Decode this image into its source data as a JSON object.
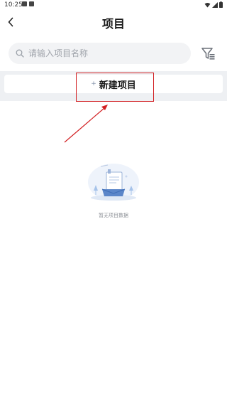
{
  "status_bar": {
    "time": "10:25"
  },
  "header": {
    "title": "项目",
    "back_icon": "chevron-left-icon"
  },
  "search": {
    "placeholder": "请输入项目名称",
    "value": "",
    "icon": "search-icon"
  },
  "filter": {
    "icon": "filter-icon"
  },
  "new_project": {
    "plus": "+",
    "label": "新建项目"
  },
  "empty_state": {
    "text": "暂无项目数据",
    "icon": "empty-box-illustration"
  },
  "colors": {
    "highlight": "#d21f22",
    "band": "#eef0f3",
    "search_bg": "#f2f3f5"
  }
}
